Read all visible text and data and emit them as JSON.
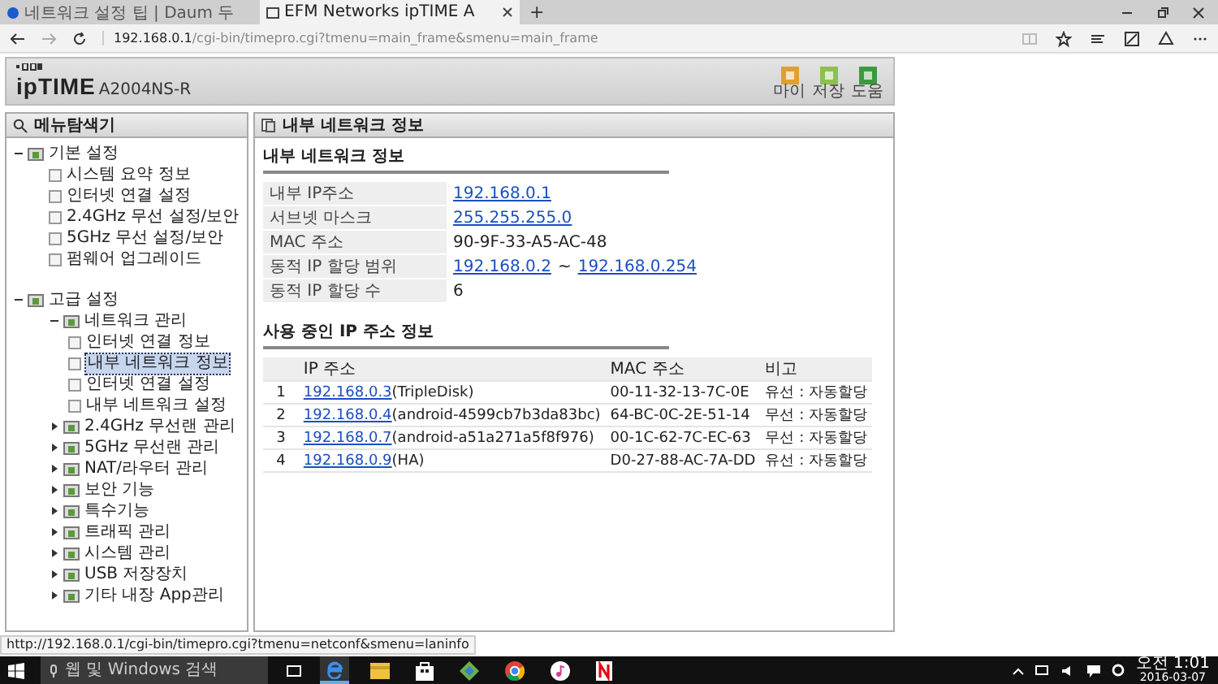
{
  "browser": {
    "tabs": [
      {
        "label": "네트워크 설정 팁 | Daum 두",
        "selected": false,
        "kind": "site"
      },
      {
        "label": "EFM Networks ipTIME A",
        "selected": true,
        "kind": "page"
      }
    ],
    "new_tab": "+",
    "address_host": "192.168.0.1",
    "address_path": "/cgi-bin/timepro.cgi?tmenu=main_frame&smenu=main_frame"
  },
  "header": {
    "logo": "ipTIME",
    "model": "A2004NS-R",
    "buttons": [
      {
        "label": "마이",
        "color": "#e0a030"
      },
      {
        "label": "저장",
        "color": "#8cc050"
      },
      {
        "label": "도움",
        "color": "#3c9a3c"
      }
    ]
  },
  "sidebar": {
    "title": "메뉴탐색기",
    "tree": [
      {
        "label": "기본 설정",
        "selected": false,
        "expanded": true,
        "children": [
          {
            "label": "시스템 요약 정보",
            "selected": false
          },
          {
            "label": "인터넷 연결 설정",
            "selected": false
          },
          {
            "label": "2.4GHz 무선 설정/보안",
            "selected": false
          },
          {
            "label": "5GHz 무선 설정/보안",
            "selected": false
          },
          {
            "label": "펌웨어 업그레이드",
            "selected": false
          }
        ]
      },
      {
        "label": "고급 설정",
        "selected": false,
        "expanded": true,
        "children": [
          {
            "label": "네트워크 관리",
            "selected": false,
            "expanded": true,
            "children": [
              {
                "label": "인터넷 연결 정보",
                "selected": false
              },
              {
                "label": "내부 네트워크 정보",
                "selected": true
              },
              {
                "label": "인터넷 연결 설정",
                "selected": false
              },
              {
                "label": "내부 네트워크 설정",
                "selected": false
              }
            ]
          },
          {
            "label": "2.4GHz 무선랜 관리",
            "selected": false,
            "expanded": false
          },
          {
            "label": "5GHz 무선랜 관리",
            "selected": false,
            "expanded": false
          },
          {
            "label": "NAT/라우터 관리",
            "selected": false,
            "expanded": false
          },
          {
            "label": "보안 기능",
            "selected": false,
            "expanded": false
          },
          {
            "label": "특수기능",
            "selected": false,
            "expanded": false
          },
          {
            "label": "트래픽 관리",
            "selected": false,
            "expanded": false
          },
          {
            "label": "시스템 관리",
            "selected": false,
            "expanded": false
          },
          {
            "label": "USB 저장장치",
            "selected": false,
            "expanded": false
          },
          {
            "label": "기타 내장 App관리",
            "selected": false,
            "expanded": false
          }
        ]
      }
    ]
  },
  "main": {
    "title": "내부 네트워크 정보",
    "info_title": "내부 네트워크 정보",
    "info": [
      {
        "label": "내부 IP주소",
        "kind": "link",
        "values": [
          "192.168.0.1"
        ]
      },
      {
        "label": "서브넷 마스크",
        "kind": "link",
        "values": [
          "255.255.255.0"
        ]
      },
      {
        "label": "MAC 주소",
        "kind": "text",
        "values": [
          "90-9F-33-A5-AC-48"
        ]
      },
      {
        "label": "동적 IP 할당 범위",
        "kind": "range",
        "values": [
          "192.168.0.2",
          "~",
          "192.168.0.254"
        ]
      },
      {
        "label": "동적 IP 할당 수",
        "kind": "text",
        "values": [
          "6"
        ]
      }
    ],
    "clients_title": "사용 중인 IP 주소 정보",
    "columns": [
      "IP 주소",
      "MAC 주소",
      "비고"
    ],
    "clients": [
      {
        "no": "1",
        "ip": "192.168.0.3",
        "host": "(TripleDisk)",
        "mac": "00-11-32-13-7C-0E",
        "note": "유선 : 자동할당"
      },
      {
        "no": "2",
        "ip": "192.168.0.4",
        "host": "(android-4599cb7b3da83bc)",
        "mac": "64-BC-0C-2E-51-14",
        "note": "무선 : 자동할당"
      },
      {
        "no": "3",
        "ip": "192.168.0.7",
        "host": "(android-a51a271a5f8f976)",
        "mac": "00-1C-62-7C-EC-63",
        "note": "무선 : 자동할당"
      },
      {
        "no": "4",
        "ip": "192.168.0.9",
        "host": "(HA)",
        "mac": "D0-27-88-AC-7A-DD",
        "note": "유선 : 자동할당"
      }
    ]
  },
  "status_url": "http://192.168.0.1/cgi-bin/timepro.cgi?tmenu=netconf&smenu=laninfo",
  "taskbar": {
    "search_placeholder": "웹 및 Windows 검색",
    "time": "오전 1:01",
    "date": "2016-03-07"
  }
}
